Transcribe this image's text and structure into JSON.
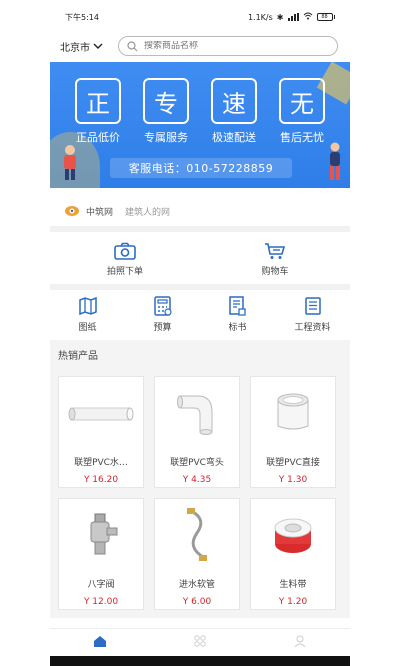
{
  "status": {
    "time": "下午5:14",
    "speed": "1.1K/s",
    "battery": "88"
  },
  "header": {
    "city": "北京市",
    "search_placeholder": "搜索商品名称"
  },
  "banner": {
    "tiles": [
      {
        "char": "正",
        "caption": "正品低价"
      },
      {
        "char": "专",
        "caption": "专属服务"
      },
      {
        "char": "速",
        "caption": "极速配送"
      },
      {
        "char": "无",
        "caption": "售后无忧"
      }
    ],
    "hotline": "客服电话：010-57228859"
  },
  "slogan": {
    "brand": "中筑网",
    "tagline": "建筑人的网"
  },
  "quick_actions": [
    {
      "label": "拍照下单",
      "icon": "camera-icon"
    },
    {
      "label": "购物车",
      "icon": "cart-icon"
    }
  ],
  "tools": [
    {
      "label": "图纸",
      "icon": "map-icon"
    },
    {
      "label": "预算",
      "icon": "calculator-icon"
    },
    {
      "label": "标书",
      "icon": "document-icon"
    },
    {
      "label": "工程资料",
      "icon": "list-icon"
    }
  ],
  "section": {
    "title": "热销产品"
  },
  "products": [
    {
      "name": "联塑PVC水…",
      "price": "Y 16.20",
      "icon": "pipe-image"
    },
    {
      "name": "联塑PVC弯头",
      "price": "Y 4.35",
      "icon": "elbow-image"
    },
    {
      "name": "联塑PVC直接",
      "price": "Y 1.30",
      "icon": "coupling-image"
    },
    {
      "name": "八字阀",
      "price": "Y 12.00",
      "icon": "valve-image"
    },
    {
      "name": "进水软管",
      "price": "Y 6.00",
      "icon": "hose-image"
    },
    {
      "name": "生料带",
      "price": "Y 1.20",
      "icon": "tape-image"
    }
  ],
  "tabbar": [
    {
      "icon": "home-icon",
      "active": true
    },
    {
      "icon": "category-icon",
      "active": false
    },
    {
      "icon": "user-icon",
      "active": false
    }
  ],
  "colors": {
    "banner": "#2f7ee8",
    "accent": "#2b6cc4",
    "price": "#d6232a",
    "section_bg": "#f4f4f4"
  }
}
